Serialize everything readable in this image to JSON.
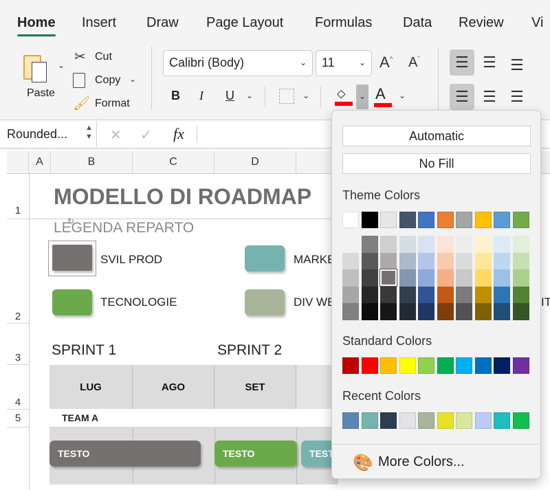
{
  "tabs": [
    "Home",
    "Insert",
    "Draw",
    "Page Layout",
    "Formulas",
    "Data",
    "Review",
    "Vi"
  ],
  "ribbon": {
    "paste": "Paste",
    "cut": "Cut",
    "copy": "Copy",
    "format": "Format",
    "font": "Calibri (Body)",
    "size": "11",
    "bold": "B",
    "italic": "I",
    "underline": "U",
    "font_color": "A",
    "grow": "A",
    "shrink": "A"
  },
  "formula_bar": {
    "name_box": "Rounded...",
    "fx": "fx",
    "cancel": "✕",
    "enter": "✓"
  },
  "columns": [
    "A",
    "B",
    "C",
    "D"
  ],
  "rows": [
    "1",
    "2",
    "3",
    "4",
    "5"
  ],
  "sheet": {
    "title": "MODELLO DI ROADMAP",
    "legend_title": "LEGENDA REPARTO",
    "legend": [
      {
        "label": "SVIL PROD",
        "color": "#767171"
      },
      {
        "label": "MARKE",
        "color": "#76B3AF"
      },
      {
        "label": "TECNOLOGIE",
        "color": "#6BAA4A"
      },
      {
        "label": "DIV WE",
        "color": "#A8B59A"
      }
    ],
    "sprint1": "SPRINT 1",
    "sprint2": "SPRINT 2",
    "months": [
      "LUG",
      "AGO",
      "SET",
      ""
    ],
    "team": "TEAM A",
    "bars": [
      {
        "label": "TESTO",
        "color": "#767171"
      },
      {
        "label": "TESTO",
        "color": "#6BAA4A"
      },
      {
        "label": "TESTO",
        "color": "#76B3AF"
      }
    ],
    "cut_text": "IT"
  },
  "fill_menu": {
    "automatic": "Automatic",
    "no_fill": "No Fill",
    "theme_label": "Theme Colors",
    "standard_label": "Standard Colors",
    "recent_label": "Recent Colors",
    "more": "More Colors...",
    "theme": [
      "#FFFFFF",
      "#000000",
      "#E7E6E6",
      "#44546A",
      "#4472C4",
      "#ED7D31",
      "#A5A5A5",
      "#FFC000",
      "#5B9BD5",
      "#70AD47"
    ],
    "shades": [
      [
        "#F2F2F2",
        "#D9D9D9",
        "#BFBFBF",
        "#A6A6A6",
        "#808080"
      ],
      [
        "#808080",
        "#595959",
        "#404040",
        "#262626",
        "#0D0D0D"
      ],
      [
        "#D0CECE",
        "#AEAAAA",
        "#757171",
        "#3A3838",
        "#171717"
      ],
      [
        "#D6DCE4",
        "#ACB9CA",
        "#8497B0",
        "#333F4F",
        "#222B35"
      ],
      [
        "#D9E1F2",
        "#B4C6E7",
        "#8EA9DB",
        "#305496",
        "#203764"
      ],
      [
        "#FCE4D6",
        "#F8CBAD",
        "#F4B084",
        "#C65911",
        "#833C0C"
      ],
      [
        "#EDEDED",
        "#DBDBDB",
        "#C9C9C9",
        "#7B7B7B",
        "#525252"
      ],
      [
        "#FFF2CC",
        "#FFE699",
        "#FFD966",
        "#BF8F00",
        "#806000"
      ],
      [
        "#DDEBF7",
        "#BDD7EE",
        "#9BC2E6",
        "#2F75B5",
        "#1F4E78"
      ],
      [
        "#E2EFDA",
        "#C6E0B4",
        "#A9D08E",
        "#548235",
        "#375623"
      ]
    ],
    "selected": {
      "column": 3,
      "shade": 3
    },
    "standard": [
      "#C00000",
      "#FF0000",
      "#FFC000",
      "#FFFF00",
      "#92D050",
      "#00B050",
      "#00B0F0",
      "#0070C0",
      "#002060",
      "#7030A0"
    ],
    "recent": [
      "#5B86B4",
      "#76B3AF",
      "#2E3E52",
      "#E1E3E6",
      "#A8B59A",
      "#E5E22A",
      "#D8E89A",
      "#BACBF5",
      "#1FBCC0",
      "#12BE4C"
    ]
  }
}
